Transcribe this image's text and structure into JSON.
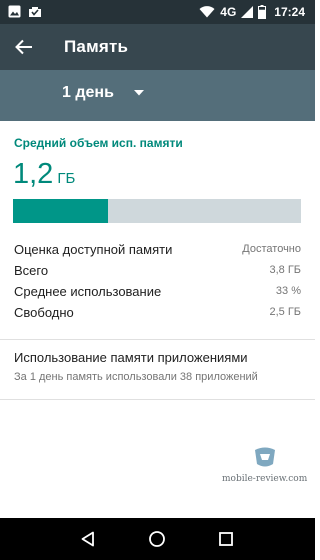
{
  "status_bar": {
    "network": "4G",
    "time": "17:24",
    "battery_level": 0.75,
    "icons": [
      "image-icon",
      "download-done-icon",
      "wifi-icon",
      "signal-icon",
      "battery-icon"
    ]
  },
  "toolbar": {
    "title": "Память",
    "back_icon": "arrow-back-icon",
    "bg_color": "#37474f"
  },
  "period_selector": {
    "selected": "1 день",
    "icon": "dropdown-arrow-icon",
    "bg_color": "#546e7a"
  },
  "memory": {
    "section_title": "Средний объем исп. памяти",
    "value": "1,2",
    "unit": "ГБ",
    "usage_fraction": 0.33,
    "accent_color": "#009688",
    "stats": [
      {
        "label": "Оценка доступной памяти",
        "value": "Достаточно"
      },
      {
        "label": "Всего",
        "value": "3,8 ГБ"
      },
      {
        "label": "Среднее использование",
        "value": "33 %"
      },
      {
        "label": "Свободно",
        "value": "2,5 ГБ"
      }
    ]
  },
  "apps_usage": {
    "title": "Использование памяти приложениями",
    "subtitle": "За 1 день память использовали 38 приложений"
  },
  "watermark": {
    "text": "mobile-review.com"
  },
  "nav_bar": {
    "icons": [
      "back-triangle-icon",
      "home-circle-icon",
      "recents-square-icon"
    ]
  }
}
